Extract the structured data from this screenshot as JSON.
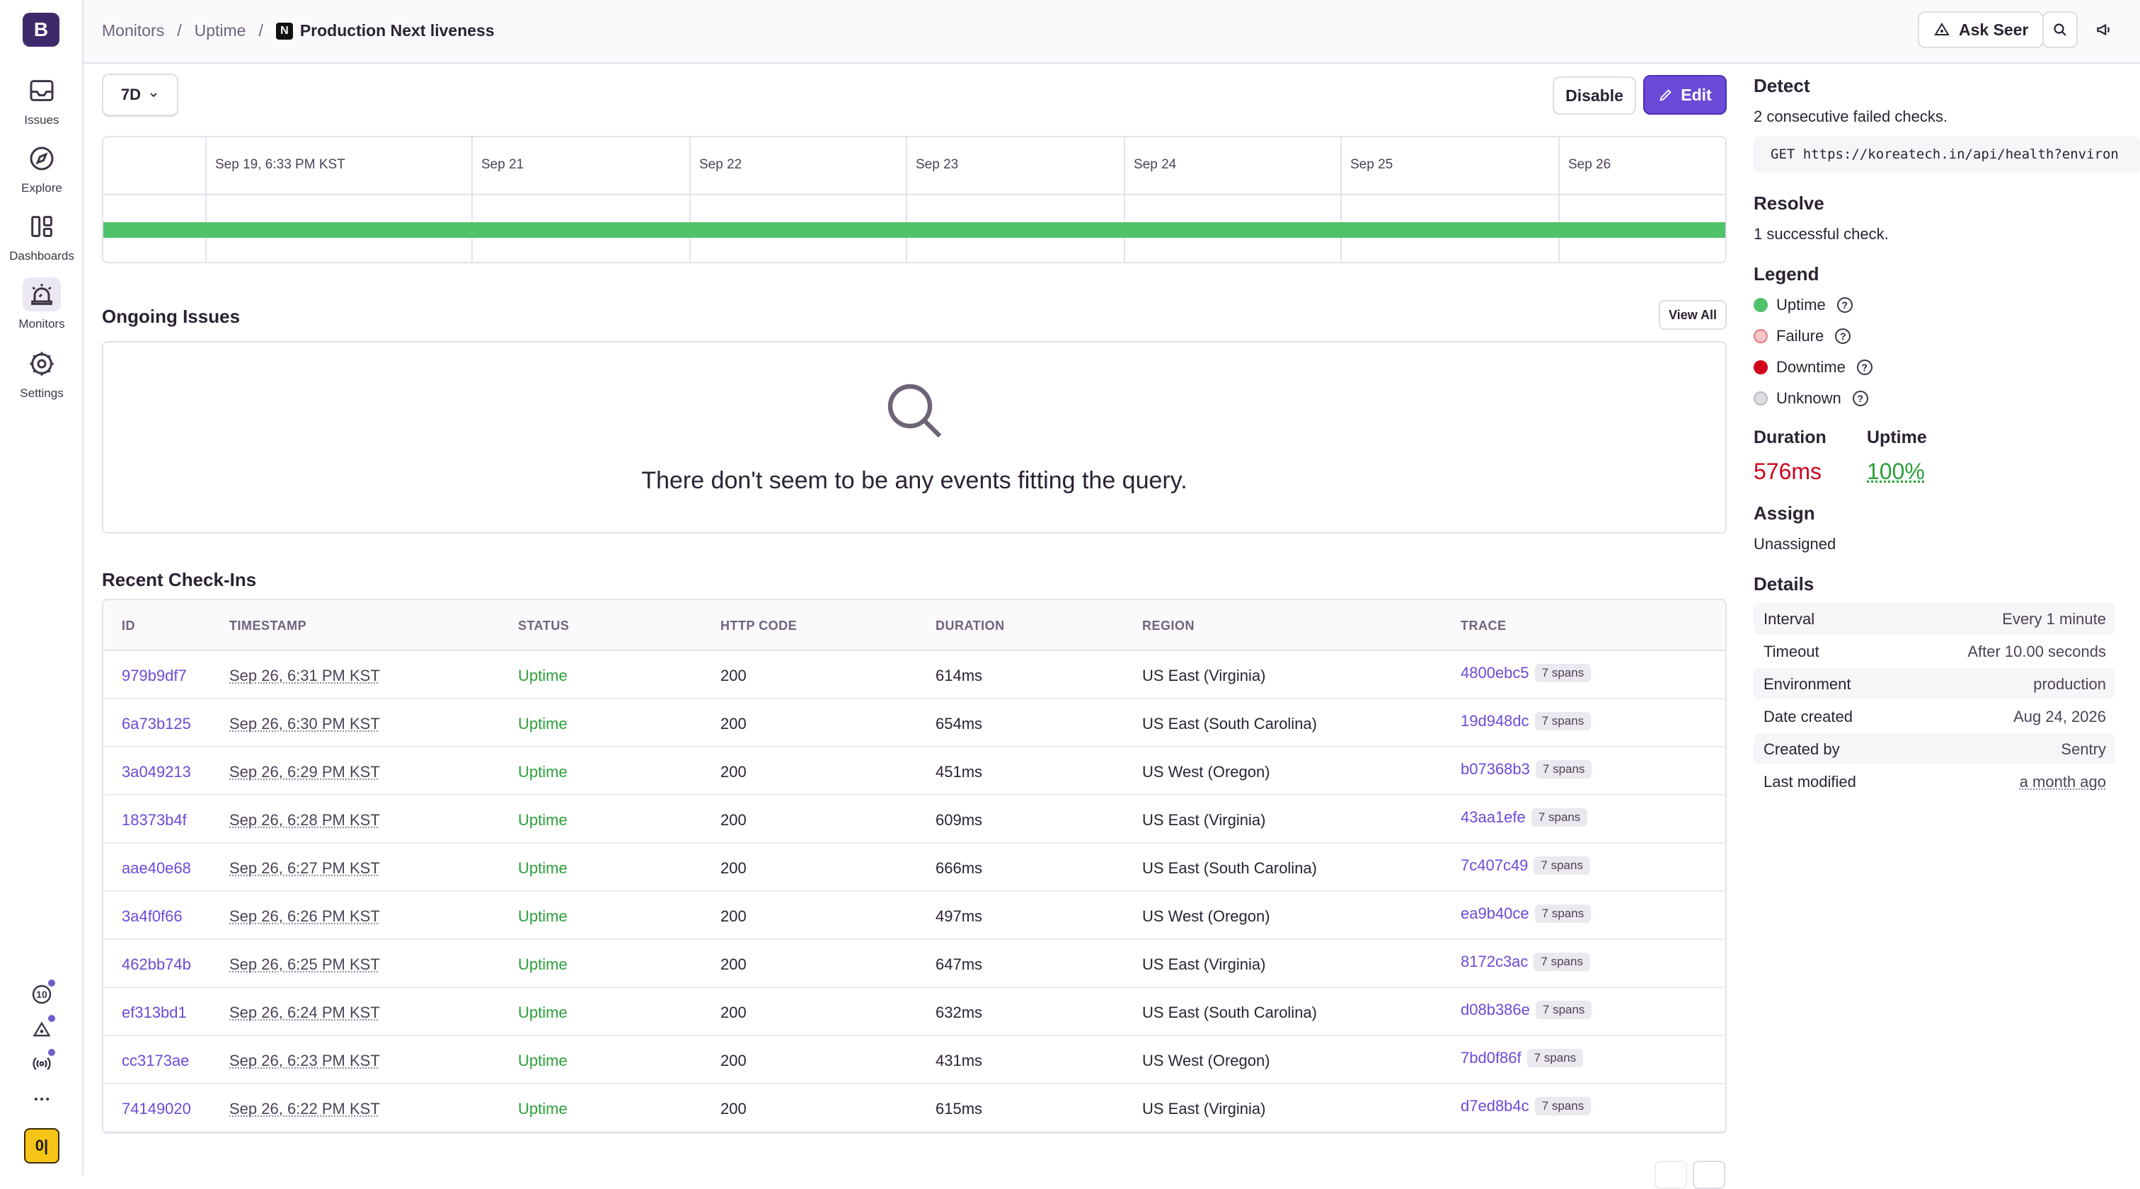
{
  "org": {
    "initial": "B"
  },
  "nav": [
    {
      "label": "Issues",
      "icon": "inbox-icon"
    },
    {
      "label": "Explore",
      "icon": "compass-icon"
    },
    {
      "label": "Dashboards",
      "icon": "dashboard-icon"
    },
    {
      "label": "Monitors",
      "icon": "siren-icon"
    },
    {
      "label": "Settings",
      "icon": "gear-icon"
    }
  ],
  "sidebar_bottom": {
    "counter": "10",
    "user_badge": "0|"
  },
  "breadcrumb": {
    "items": [
      "Monitors",
      "Uptime"
    ],
    "current": "Production Next liveness",
    "logo": "N"
  },
  "header": {
    "ask_seer": "Ask Seer"
  },
  "toolbar": {
    "range": "7D",
    "disable": "Disable",
    "edit": "Edit"
  },
  "timeline": {
    "labels": [
      "Sep 19, 6:33 PM KST",
      "Sep 21",
      "Sep 22",
      "Sep 23",
      "Sep 24",
      "Sep 25",
      "Sep 26"
    ],
    "status_color": "#4fc26a"
  },
  "ongoing": {
    "title": "Ongoing Issues",
    "view_all": "View All",
    "empty": "There don't seem to be any events fitting the query."
  },
  "checkins": {
    "title": "Recent Check-Ins",
    "columns": [
      "ID",
      "TIMESTAMP",
      "STATUS",
      "HTTP CODE",
      "DURATION",
      "REGION",
      "TRACE"
    ],
    "rows": [
      {
        "id": "979b9df7",
        "ts": "Sep 26, 6:31 PM KST",
        "status": "Uptime",
        "code": "200",
        "duration": "614ms",
        "region": "US East (Virginia)",
        "trace": "4800ebc5",
        "spans": "7 spans"
      },
      {
        "id": "6a73b125",
        "ts": "Sep 26, 6:30 PM KST",
        "status": "Uptime",
        "code": "200",
        "duration": "654ms",
        "region": "US East (South Carolina)",
        "trace": "19d948dc",
        "spans": "7 spans"
      },
      {
        "id": "3a049213",
        "ts": "Sep 26, 6:29 PM KST",
        "status": "Uptime",
        "code": "200",
        "duration": "451ms",
        "region": "US West (Oregon)",
        "trace": "b07368b3",
        "spans": "7 spans"
      },
      {
        "id": "18373b4f",
        "ts": "Sep 26, 6:28 PM KST",
        "status": "Uptime",
        "code": "200",
        "duration": "609ms",
        "region": "US East (Virginia)",
        "trace": "43aa1efe",
        "spans": "7 spans"
      },
      {
        "id": "aae40e68",
        "ts": "Sep 26, 6:27 PM KST",
        "status": "Uptime",
        "code": "200",
        "duration": "666ms",
        "region": "US East (South Carolina)",
        "trace": "7c407c49",
        "spans": "7 spans"
      },
      {
        "id": "3a4f0f66",
        "ts": "Sep 26, 6:26 PM KST",
        "status": "Uptime",
        "code": "200",
        "duration": "497ms",
        "region": "US West (Oregon)",
        "trace": "ea9b40ce",
        "spans": "7 spans"
      },
      {
        "id": "462bb74b",
        "ts": "Sep 26, 6:25 PM KST",
        "status": "Uptime",
        "code": "200",
        "duration": "647ms",
        "region": "US East (Virginia)",
        "trace": "8172c3ac",
        "spans": "7 spans"
      },
      {
        "id": "ef313bd1",
        "ts": "Sep 26, 6:24 PM KST",
        "status": "Uptime",
        "code": "200",
        "duration": "632ms",
        "region": "US East (South Carolina)",
        "trace": "d08b386e",
        "spans": "7 spans"
      },
      {
        "id": "cc3173ae",
        "ts": "Sep 26, 6:23 PM KST",
        "status": "Uptime",
        "code": "200",
        "duration": "431ms",
        "region": "US West (Oregon)",
        "trace": "7bd0f86f",
        "spans": "7 spans"
      },
      {
        "id": "74149020",
        "ts": "Sep 26, 6:22 PM KST",
        "status": "Uptime",
        "code": "200",
        "duration": "615ms",
        "region": "US East (Virginia)",
        "trace": "d7ed8b4c",
        "spans": "7 spans"
      }
    ]
  },
  "panel": {
    "detect_title": "Detect",
    "detect_text": "2 consecutive failed checks.",
    "request": "GET https://koreatech.in/api/health?environ",
    "resolve_title": "Resolve",
    "resolve_text": "1 successful check.",
    "legend_title": "Legend",
    "legend": [
      {
        "label": "Uptime",
        "color": "#4fc26a"
      },
      {
        "label": "Failure",
        "color": "#f6c6c8"
      },
      {
        "label": "Downtime",
        "color": "#d0021b"
      },
      {
        "label": "Unknown",
        "color": "#dddcdf"
      }
    ],
    "duration_label": "Duration",
    "duration_value": "576ms",
    "uptime_label": "Uptime",
    "uptime_value": "100%",
    "assign_title": "Assign",
    "assign_value": "Unassigned",
    "details_title": "Details",
    "details": [
      {
        "k": "Interval",
        "v": "Every 1 minute"
      },
      {
        "k": "Timeout",
        "v": "After 10.00 seconds"
      },
      {
        "k": "Environment",
        "v": "production"
      },
      {
        "k": "Date created",
        "v": "Aug 24, 2026"
      },
      {
        "k": "Created by",
        "v": "Sentry"
      },
      {
        "k": "Last modified",
        "v": "a month ago"
      }
    ]
  },
  "colors": {
    "accent": "#6c4ad8",
    "uptime": "#2ba039",
    "danger": "#d0021b"
  }
}
